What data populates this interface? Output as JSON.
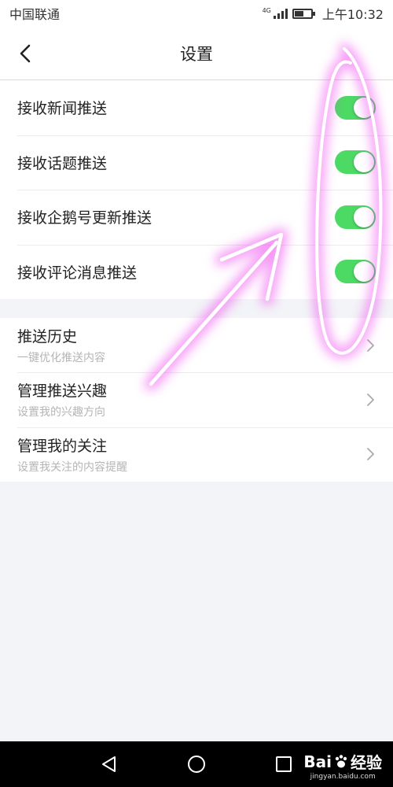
{
  "status_bar": {
    "carrier": "中国联通",
    "network": "4G",
    "time": "上午10:32"
  },
  "header": {
    "title": "设置",
    "back_icon": "chevron-left-icon"
  },
  "push_settings": [
    {
      "label": "接收新闻推送",
      "enabled": true
    },
    {
      "label": "接收话题推送",
      "enabled": true
    },
    {
      "label": "接收企鹅号更新推送",
      "enabled": true
    },
    {
      "label": "接收评论消息推送",
      "enabled": true
    }
  ],
  "links": [
    {
      "title": "推送历史",
      "subtitle": "一键优化推送内容"
    },
    {
      "title": "管理推送兴趣",
      "subtitle": "设置我的兴趣方向"
    },
    {
      "title": "管理我的关注",
      "subtitle": "设置我关注的内容提醒"
    }
  ],
  "watermark": {
    "brand": "Bai",
    "brand_suffix": "经验",
    "url": "jingyan.baidu.com"
  },
  "colors": {
    "switch_on": "#4cd964",
    "annotation": "#ee44ee",
    "background": "#f2f4f7"
  }
}
